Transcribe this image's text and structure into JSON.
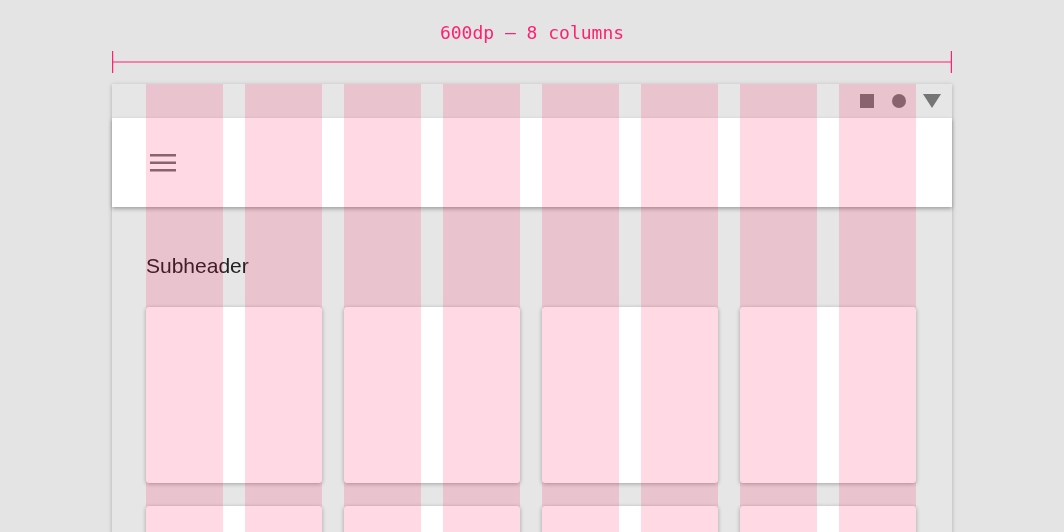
{
  "dimension_label": "600dp – 8 columns",
  "subheader": "Subheader",
  "grid_columns": [
    {
      "kind": "column"
    },
    {
      "kind": "column"
    },
    {
      "kind": "column"
    },
    {
      "kind": "column"
    },
    {
      "kind": "column"
    },
    {
      "kind": "column"
    },
    {
      "kind": "column"
    },
    {
      "kind": "column"
    }
  ],
  "cards": [
    {
      "kind": "card"
    },
    {
      "kind": "card"
    },
    {
      "kind": "card"
    },
    {
      "kind": "card"
    },
    {
      "kind": "card"
    },
    {
      "kind": "card"
    },
    {
      "kind": "card"
    },
    {
      "kind": "card"
    }
  ]
}
